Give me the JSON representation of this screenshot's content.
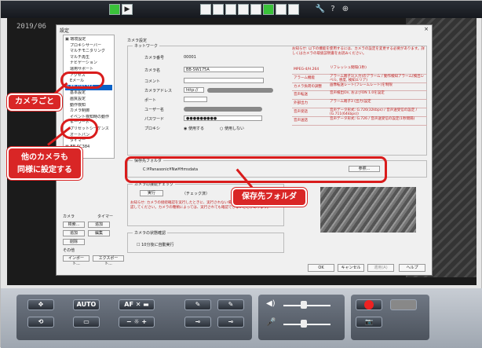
{
  "timestamp": "2019/06",
  "dialog": {
    "title": "設定",
    "close": "×",
    "tree": [
      {
        "label": "環境設定",
        "level": 0
      },
      {
        "label": "プロキシサーバー",
        "level": 1
      },
      {
        "label": "マルチモニタリング",
        "level": 1
      },
      {
        "label": "マルチ再生",
        "level": 1
      },
      {
        "label": "ナビゲーション",
        "level": 1
      },
      {
        "label": "運用サポート",
        "level": 1
      },
      {
        "label": "アクセス",
        "level": 1
      },
      {
        "label": "Eメール",
        "level": 1
      },
      {
        "label": "BB-SW175A",
        "level": 0,
        "selected": true
      },
      {
        "label": "基本設定",
        "level": 1
      },
      {
        "label": "画質設定",
        "level": 1
      },
      {
        "label": "動作検知",
        "level": 1
      },
      {
        "label": "カメラ制御",
        "level": 1
      },
      {
        "label": "イベント検知時の動作",
        "level": 1
      },
      {
        "label": "キーワード",
        "level": 1
      },
      {
        "label": "プリセットシーケンス",
        "level": 1
      },
      {
        "label": "オートパン",
        "level": 1
      },
      {
        "label": "タイマー",
        "level": 1
      },
      {
        "label": "BB-SC384",
        "level": 0
      }
    ],
    "left_tools": {
      "camera_label": "カメラ",
      "timer_label": "タイマー",
      "search": "検索...",
      "add1": "追加",
      "add2": "追加",
      "edit": "編集",
      "delete": "削除",
      "other_label": "その他",
      "import": "インポート...",
      "export": "エクスポート..."
    },
    "section_title": "カメラ設定",
    "network_label": "ネットワーク",
    "fields": {
      "camera_no_label": "カメラ番号",
      "camera_no": "00001",
      "camera_name_label": "カメラ名",
      "camera_name": "BB-SW175A",
      "comment_label": "コメント",
      "address_label": "カメラアドレス",
      "address_prefix": "http://",
      "port_label": "ポート",
      "user_label": "ユーザー名",
      "password_label": "パスワード",
      "password": "●●●●●●●●●",
      "proxy_label": "プロキシ",
      "proxy_use": "使用する",
      "proxy_nouse": "使用しない"
    },
    "save_folder": {
      "legend": "保存先フォルダ",
      "path": "C:¥Panasonic¥Nw¥Hmsdata",
      "browse": "参照..."
    },
    "connect_check": {
      "legend": "カメラの接続チェック",
      "run": "実行",
      "hint": "（チェック済）",
      "note": "お知らせ: カメラの接続確認を実行したときに、実行されない場合は、カメラの設定と通信を確認してください。カメラの種類によっては、実行されても確認できないことがあります。"
    },
    "status_check": {
      "legend": "カメラの状態確認",
      "checkbox": "10分後に自動実行"
    },
    "red_note": "お知らせ: 以下の機能を使用するには、カメラの設定を変更する必要があります。詳しくはカメラの取扱説明書をお読みください。",
    "info_table": [
      {
        "k": "MPEG-4/H.264",
        "v": "リフレッシュ間隔(1秒)"
      },
      {
        "k": "アラーム機能",
        "v": "アラーム端子1(入力)のアラーム / 動作検知アラーム(検出レベル, 感度, 検知エリア)"
      },
      {
        "k": "カメラ負荷の調整",
        "v": "画像転送レート(フレームレート)を制限"
      },
      {
        "k": "音声転送",
        "v": "音声検出On, およびON 1.0を設定"
      },
      {
        "k": "外部出力",
        "v": "アラーム端子3 (出力)設定"
      },
      {
        "k": "音声受話",
        "v": "音声データ形式: G.726(32kbps) / 音声送受信の設定 / (G.711(64kbps))"
      },
      {
        "k": "音声送話",
        "v": "音声データ形式: G.726 / 音声送受信の設定(1秒間隔)"
      }
    ],
    "buttons": {
      "ok": "OK",
      "cancel": "キャンセル",
      "apply": "適用(A)",
      "help": "ヘルプ"
    }
  },
  "callouts": {
    "per_camera": "カメラごと",
    "other_cameras": "他のカメラも\n同様に設定する",
    "save_folder": "保存先フォルダ"
  },
  "controls": {
    "auto": "AUTO",
    "af": "AF"
  },
  "colors": {
    "annotation_red": "#d91c1c",
    "selection_blue": "#0a62c7"
  }
}
